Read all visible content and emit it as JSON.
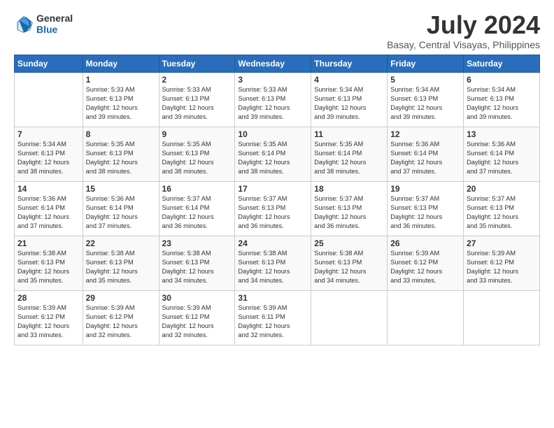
{
  "header": {
    "logo_general": "General",
    "logo_blue": "Blue",
    "title": "July 2024",
    "location": "Basay, Central Visayas, Philippines"
  },
  "days": [
    "Sunday",
    "Monday",
    "Tuesday",
    "Wednesday",
    "Thursday",
    "Friday",
    "Saturday"
  ],
  "weeks": [
    [
      {
        "num": "",
        "sunrise": "",
        "sunset": "",
        "daylight": ""
      },
      {
        "num": "1",
        "sunrise": "Sunrise: 5:33 AM",
        "sunset": "Sunset: 6:13 PM",
        "daylight": "Daylight: 12 hours and 39 minutes."
      },
      {
        "num": "2",
        "sunrise": "Sunrise: 5:33 AM",
        "sunset": "Sunset: 6:13 PM",
        "daylight": "Daylight: 12 hours and 39 minutes."
      },
      {
        "num": "3",
        "sunrise": "Sunrise: 5:33 AM",
        "sunset": "Sunset: 6:13 PM",
        "daylight": "Daylight: 12 hours and 39 minutes."
      },
      {
        "num": "4",
        "sunrise": "Sunrise: 5:34 AM",
        "sunset": "Sunset: 6:13 PM",
        "daylight": "Daylight: 12 hours and 39 minutes."
      },
      {
        "num": "5",
        "sunrise": "Sunrise: 5:34 AM",
        "sunset": "Sunset: 6:13 PM",
        "daylight": "Daylight: 12 hours and 39 minutes."
      },
      {
        "num": "6",
        "sunrise": "Sunrise: 5:34 AM",
        "sunset": "Sunset: 6:13 PM",
        "daylight": "Daylight: 12 hours and 39 minutes."
      }
    ],
    [
      {
        "num": "7",
        "sunrise": "Sunrise: 5:34 AM",
        "sunset": "Sunset: 6:13 PM",
        "daylight": "Daylight: 12 hours and 38 minutes."
      },
      {
        "num": "8",
        "sunrise": "Sunrise: 5:35 AM",
        "sunset": "Sunset: 6:13 PM",
        "daylight": "Daylight: 12 hours and 38 minutes."
      },
      {
        "num": "9",
        "sunrise": "Sunrise: 5:35 AM",
        "sunset": "Sunset: 6:13 PM",
        "daylight": "Daylight: 12 hours and 38 minutes."
      },
      {
        "num": "10",
        "sunrise": "Sunrise: 5:35 AM",
        "sunset": "Sunset: 6:14 PM",
        "daylight": "Daylight: 12 hours and 38 minutes."
      },
      {
        "num": "11",
        "sunrise": "Sunrise: 5:35 AM",
        "sunset": "Sunset: 6:14 PM",
        "daylight": "Daylight: 12 hours and 38 minutes."
      },
      {
        "num": "12",
        "sunrise": "Sunrise: 5:36 AM",
        "sunset": "Sunset: 6:14 PM",
        "daylight": "Daylight: 12 hours and 37 minutes."
      },
      {
        "num": "13",
        "sunrise": "Sunrise: 5:36 AM",
        "sunset": "Sunset: 6:14 PM",
        "daylight": "Daylight: 12 hours and 37 minutes."
      }
    ],
    [
      {
        "num": "14",
        "sunrise": "Sunrise: 5:36 AM",
        "sunset": "Sunset: 6:14 PM",
        "daylight": "Daylight: 12 hours and 37 minutes."
      },
      {
        "num": "15",
        "sunrise": "Sunrise: 5:36 AM",
        "sunset": "Sunset: 6:14 PM",
        "daylight": "Daylight: 12 hours and 37 minutes."
      },
      {
        "num": "16",
        "sunrise": "Sunrise: 5:37 AM",
        "sunset": "Sunset: 6:14 PM",
        "daylight": "Daylight: 12 hours and 36 minutes."
      },
      {
        "num": "17",
        "sunrise": "Sunrise: 5:37 AM",
        "sunset": "Sunset: 6:13 PM",
        "daylight": "Daylight: 12 hours and 36 minutes."
      },
      {
        "num": "18",
        "sunrise": "Sunrise: 5:37 AM",
        "sunset": "Sunset: 6:13 PM",
        "daylight": "Daylight: 12 hours and 36 minutes."
      },
      {
        "num": "19",
        "sunrise": "Sunrise: 5:37 AM",
        "sunset": "Sunset: 6:13 PM",
        "daylight": "Daylight: 12 hours and 36 minutes."
      },
      {
        "num": "20",
        "sunrise": "Sunrise: 5:37 AM",
        "sunset": "Sunset: 6:13 PM",
        "daylight": "Daylight: 12 hours and 35 minutes."
      }
    ],
    [
      {
        "num": "21",
        "sunrise": "Sunrise: 5:38 AM",
        "sunset": "Sunset: 6:13 PM",
        "daylight": "Daylight: 12 hours and 35 minutes."
      },
      {
        "num": "22",
        "sunrise": "Sunrise: 5:38 AM",
        "sunset": "Sunset: 6:13 PM",
        "daylight": "Daylight: 12 hours and 35 minutes."
      },
      {
        "num": "23",
        "sunrise": "Sunrise: 5:38 AM",
        "sunset": "Sunset: 6:13 PM",
        "daylight": "Daylight: 12 hours and 34 minutes."
      },
      {
        "num": "24",
        "sunrise": "Sunrise: 5:38 AM",
        "sunset": "Sunset: 6:13 PM",
        "daylight": "Daylight: 12 hours and 34 minutes."
      },
      {
        "num": "25",
        "sunrise": "Sunrise: 5:38 AM",
        "sunset": "Sunset: 6:13 PM",
        "daylight": "Daylight: 12 hours and 34 minutes."
      },
      {
        "num": "26",
        "sunrise": "Sunrise: 5:39 AM",
        "sunset": "Sunset: 6:12 PM",
        "daylight": "Daylight: 12 hours and 33 minutes."
      },
      {
        "num": "27",
        "sunrise": "Sunrise: 5:39 AM",
        "sunset": "Sunset: 6:12 PM",
        "daylight": "Daylight: 12 hours and 33 minutes."
      }
    ],
    [
      {
        "num": "28",
        "sunrise": "Sunrise: 5:39 AM",
        "sunset": "Sunset: 6:12 PM",
        "daylight": "Daylight: 12 hours and 33 minutes."
      },
      {
        "num": "29",
        "sunrise": "Sunrise: 5:39 AM",
        "sunset": "Sunset: 6:12 PM",
        "daylight": "Daylight: 12 hours and 32 minutes."
      },
      {
        "num": "30",
        "sunrise": "Sunrise: 5:39 AM",
        "sunset": "Sunset: 6:12 PM",
        "daylight": "Daylight: 12 hours and 32 minutes."
      },
      {
        "num": "31",
        "sunrise": "Sunrise: 5:39 AM",
        "sunset": "Sunset: 6:11 PM",
        "daylight": "Daylight: 12 hours and 32 minutes."
      },
      {
        "num": "",
        "sunrise": "",
        "sunset": "",
        "daylight": ""
      },
      {
        "num": "",
        "sunrise": "",
        "sunset": "",
        "daylight": ""
      },
      {
        "num": "",
        "sunrise": "",
        "sunset": "",
        "daylight": ""
      }
    ]
  ]
}
